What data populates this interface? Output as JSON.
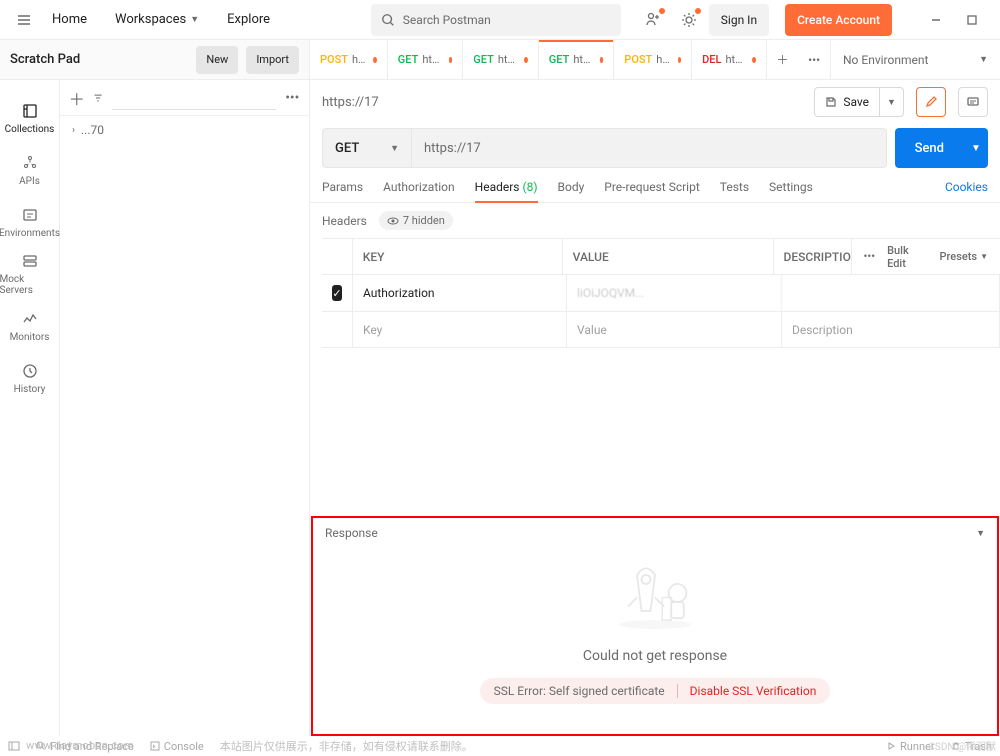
{
  "topnav": {
    "home": "Home",
    "workspaces": "Workspaces",
    "explore": "Explore",
    "search_placeholder": "Search Postman",
    "signin": "Sign In",
    "create_account": "Create Account"
  },
  "scratch": {
    "title": "Scratch Pad",
    "new": "New",
    "import": "Import"
  },
  "sidebar": {
    "items": [
      {
        "label": "Collections"
      },
      {
        "label": "APIs"
      },
      {
        "label": "Environments"
      },
      {
        "label": "Mock Servers"
      },
      {
        "label": "Monitors"
      },
      {
        "label": "History"
      }
    ]
  },
  "tree": {
    "item1": "...70"
  },
  "tabs": [
    {
      "method": "POST",
      "url": "https:"
    },
    {
      "method": "GET",
      "url": "https:/"
    },
    {
      "method": "GET",
      "url": "https:/"
    },
    {
      "method": "GET",
      "url": "https:/",
      "active": true
    },
    {
      "method": "POST",
      "url": "https:"
    },
    {
      "method": "DEL",
      "url": "https:/"
    }
  ],
  "env": {
    "label": "No Environment"
  },
  "request": {
    "title": "https://17",
    "method": "GET",
    "url": "https://17",
    "save": "Save",
    "send": "Send",
    "tabs": {
      "params": "Params",
      "auth": "Authorization",
      "headers": "Headers",
      "headers_count": "(8)",
      "body": "Body",
      "prereq": "Pre-request Script",
      "tests": "Tests",
      "settings": "Settings",
      "cookies": "Cookies"
    },
    "headers_label": "Headers",
    "hidden_label": "7 hidden",
    "cols": {
      "key": "KEY",
      "value": "VALUE",
      "desc": "DESCRIPTIO",
      "bulk": "Bulk Edit",
      "presets": "Presets"
    },
    "rows": [
      {
        "checked": true,
        "key": "Authorization",
        "value": "liOiJOQVM...",
        "desc": ""
      }
    ],
    "placeholder": {
      "key": "Key",
      "value": "Value",
      "desc": "Description"
    }
  },
  "response": {
    "title": "Response",
    "msg": "Could not get response",
    "ssl_error": "SSL Error: Self signed certificate",
    "ssl_action": "Disable SSL Verification"
  },
  "footer": {
    "find": "Find and Replace",
    "console": "Console",
    "runner": "Runner",
    "trash": "Trash",
    "watermark": "本站图片仅供展示，非存储，如有侵权请联系删除。",
    "wm_left": "www.daymoban.com",
    "csdn": "CSDN @悕羽獸"
  }
}
